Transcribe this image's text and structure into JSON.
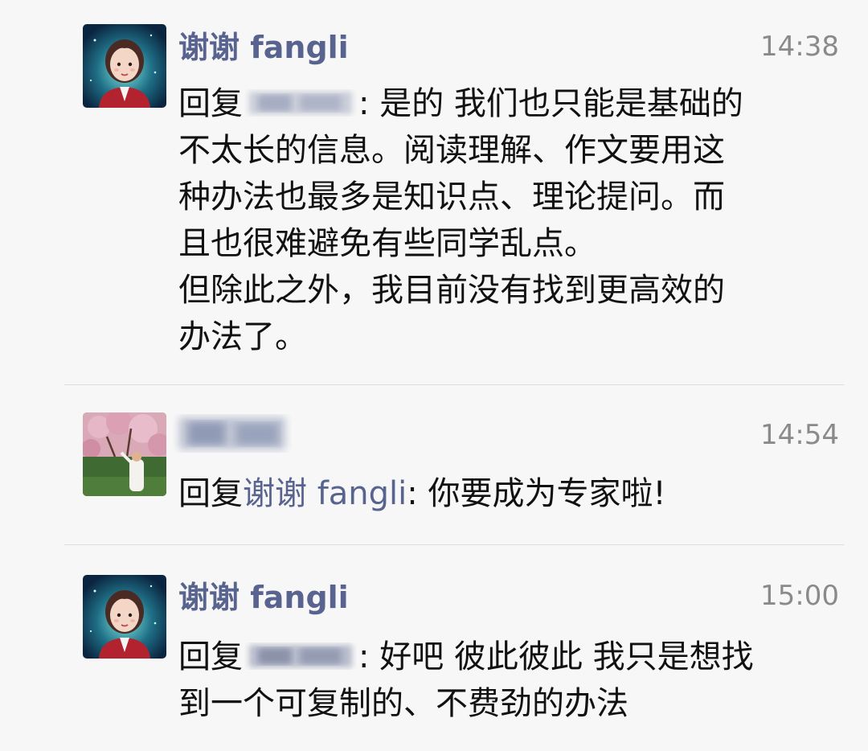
{
  "comments": [
    {
      "author": "谢谢 fangli",
      "time": "14:38",
      "reply_prefix": "回复",
      "lines_first_suffix": ": 是的  我们也只能是基础的",
      "lines": [
        "不太长的信息。阅读理解、作文要用这",
        "种办法也最多是知识点、理论提问。而",
        "且也很难避免有些同学乱点。",
        "但除此之外，我目前没有找到更高效的",
        "办法了。"
      ],
      "avatar_icon": "cartoon-girl-avatar"
    },
    {
      "time": "14:54",
      "reply_prefix": "回复",
      "reply_to": "谢谢 fangli",
      "text": ": 你要成为专家啦!",
      "avatar_icon": "cherry-blossom-photo-avatar"
    },
    {
      "author": "谢谢 fangli",
      "time": "15:00",
      "reply_prefix": "回复",
      "lines_first_suffix": ": 好吧  彼此彼此 我只是想找",
      "lines": [
        "到一个可复制的、不费劲的办法"
      ],
      "avatar_icon": "cartoon-girl-avatar"
    }
  ],
  "colors": {
    "name": "#58648f",
    "time": "#8a8a8a",
    "text": "#111111",
    "background": "#f7f7f7"
  }
}
